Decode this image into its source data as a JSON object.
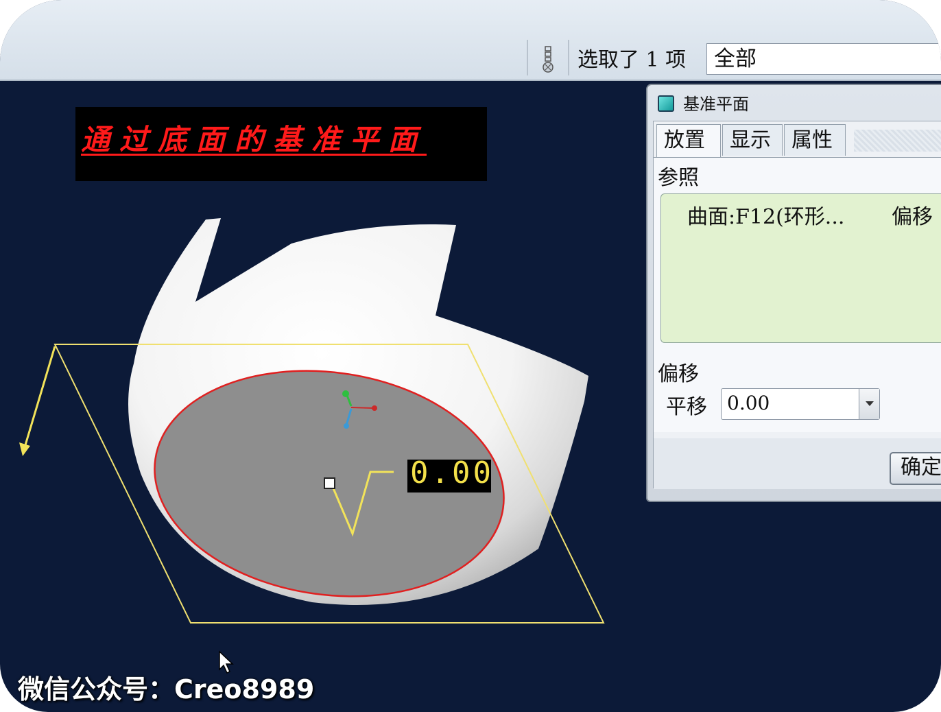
{
  "toolbar": {
    "filter_icon": "filter-icon",
    "selection_status": "选取了 1 项",
    "filter_value": "全部"
  },
  "viewport": {
    "background_color": "#0c1a38",
    "caption": "通过底面的基准平面",
    "caption_color": "#ff1a1a",
    "dimension_value": "0.00",
    "dimension_color": "#f3e04a",
    "plane_outline_color": "#f0e070",
    "edge_highlight_color": "#e02020"
  },
  "dialog": {
    "title": "基准平面",
    "tabs": [
      {
        "label": "放置",
        "active": true
      },
      {
        "label": "显示",
        "active": false
      },
      {
        "label": "属性",
        "active": false
      }
    ],
    "references_label": "参照",
    "reference_item": "曲面:F12(环形...",
    "reference_constraint": "偏移",
    "offset_section_label": "偏移",
    "translation_label": "平移",
    "translation_value": "0.00",
    "ok_label": "确定",
    "reference_box_color": "#e2f2d0"
  },
  "watermark": "微信公众号：Creo8989"
}
